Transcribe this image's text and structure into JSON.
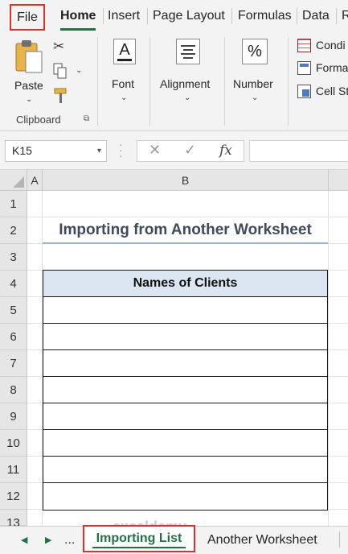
{
  "ribbon_tabs": [
    "File",
    "Home",
    "Insert",
    "Page Layout",
    "Formulas",
    "Data",
    "R"
  ],
  "clipboard": {
    "paste_label": "Paste",
    "group_label": "Clipboard"
  },
  "font_label": "Font",
  "alignment_label": "Alignment",
  "number": {
    "label": "Number",
    "icon_glyph": "%"
  },
  "styles": {
    "conditional": "Condi",
    "format": "Forma",
    "cell_styles": "Cell St"
  },
  "formula_bar": {
    "name_box": "K15",
    "fx": "fx",
    "value": ""
  },
  "columns": [
    "A",
    "B"
  ],
  "rows": [
    "1",
    "2",
    "3",
    "4",
    "5",
    "6",
    "7",
    "8",
    "9",
    "10",
    "11",
    "12",
    "13"
  ],
  "sheet": {
    "title": "Importing from Another Worksheet",
    "table_header": "Names of Clients",
    "table_rows": [
      "",
      "",
      "",
      "",
      "",
      "",
      "",
      ""
    ]
  },
  "sheet_tabs": {
    "ellipsis": "...",
    "active": "Importing List",
    "other": "Another Worksheet"
  },
  "watermark": "exceldemy",
  "colors": {
    "accent": "#217346",
    "highlight": "#e0302a",
    "header_fill": "#dce6f2",
    "title_underline": "#9db4d6"
  }
}
